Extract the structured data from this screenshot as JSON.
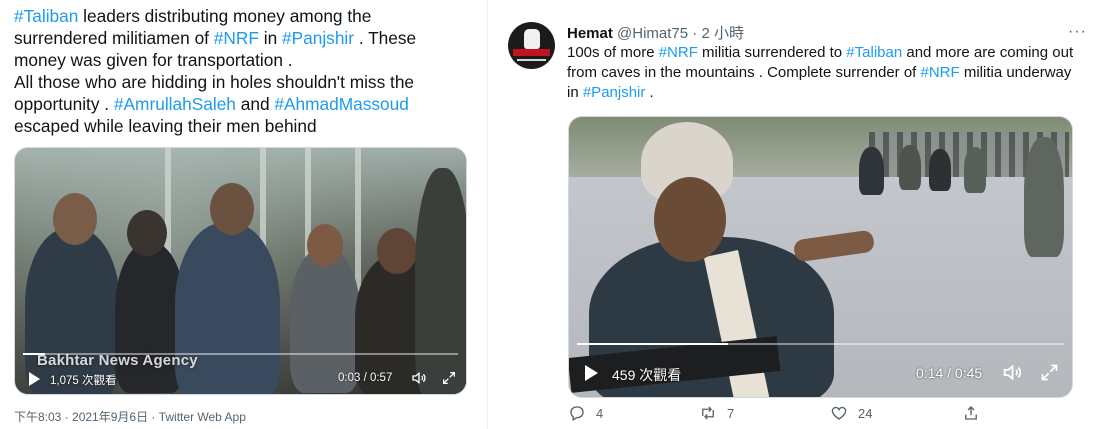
{
  "left_tweet": {
    "segments": [
      {
        "text": "#Taliban",
        "tag": true
      },
      {
        "text": " leaders distributing money among the\nsurrendered militiamen of ",
        "tag": false
      },
      {
        "text": "#NRF",
        "tag": true
      },
      {
        "text": " in ",
        "tag": false
      },
      {
        "text": "#Panjshir",
        "tag": true
      },
      {
        "text": " . These\nmoney was given for transportation .\nAll those who are hidding in holes shouldn't miss the\nopportunity . ",
        "tag": false
      },
      {
        "text": "#AmrullahSaleh",
        "tag": true
      },
      {
        "text": " and ",
        "tag": false
      },
      {
        "text": "#AhmadMassoud",
        "tag": true
      },
      {
        "text": "\nescaped while leaving their men behind",
        "tag": false
      }
    ],
    "video": {
      "watermark": "Bakhtar News Agency",
      "views": "1,075 次觀看",
      "time": "0:03 / 0:57",
      "progress": 0.05
    },
    "meta": "下午8:03 · 2021年9月6日 · Twitter Web App"
  },
  "right_tweet": {
    "author_name": "Hemat",
    "handle": "@Himat75",
    "dot": "·",
    "relative_time": "2 小時",
    "more_icon": "more-icon",
    "segments": [
      {
        "text": "100s of more ",
        "tag": false
      },
      {
        "text": "#NRF",
        "tag": true
      },
      {
        "text": " militia surrendered to ",
        "tag": false
      },
      {
        "text": "#Taliban",
        "tag": true
      },
      {
        "text": " and more are coming out from caves in the mountains . Complete surrender of ",
        "tag": false
      },
      {
        "text": "#NRF",
        "tag": true
      },
      {
        "text": " militia underway in ",
        "tag": false
      },
      {
        "text": "#Panjshir",
        "tag": true
      },
      {
        "text": " .",
        "tag": false
      }
    ],
    "video": {
      "views": "459 次觀看",
      "time": "0:14 / 0:45",
      "progress": 0.31
    },
    "actions": [
      {
        "name": "reply",
        "icon": "reply-icon",
        "count": "4"
      },
      {
        "name": "retweet",
        "icon": "retweet-icon",
        "count": "7"
      },
      {
        "name": "like",
        "icon": "heart-icon",
        "count": "24"
      },
      {
        "name": "share",
        "icon": "share-icon",
        "count": ""
      }
    ]
  },
  "colors": {
    "hashtag": "#1d9bf0",
    "text": "#0f1419",
    "secondary": "#536471",
    "border": "#cfd9de"
  }
}
